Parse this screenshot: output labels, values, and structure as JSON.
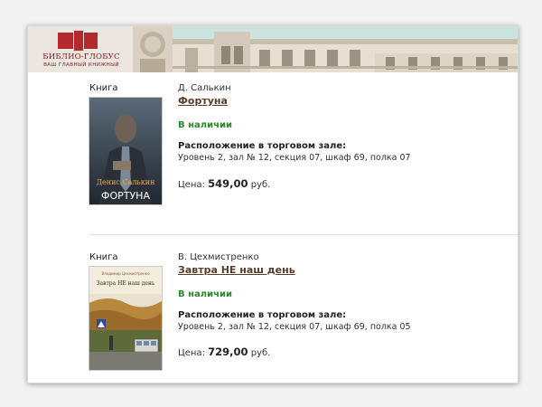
{
  "header": {
    "logo_title": "БИБЛИО-ГЛОБУС",
    "logo_subtitle": "ВАШ ГЛАВНЫЙ КНИЖНЫЙ"
  },
  "books": [
    {
      "type_label": "Книга",
      "author": "Д. Салькин",
      "title": "Фортуна",
      "availability": "В наличии",
      "location_heading": "Расположение в торговом зале:",
      "location": "Уровень 2, зал № 12, секция 07, шкаф 69, полка 07",
      "price_label": "Цена:",
      "price_value": "549,00",
      "price_currency": "руб.",
      "cover_author": "Денис Салькин",
      "cover_title": "ФОРТУНА"
    },
    {
      "type_label": "Книга",
      "author": "В. Цехмистренко",
      "title": "Завтра НЕ наш день",
      "availability": "В наличии",
      "location_heading": "Расположение в торговом зале:",
      "location": "Уровень 2, зал № 12, секция 07, шкаф 69, полка 05",
      "price_label": "Цена:",
      "price_value": "729,00",
      "price_currency": "руб.",
      "cover_title": "Завтра НЕ наш день"
    }
  ],
  "colors": {
    "title_link": "#5a3c2b",
    "availability": "#2a8a2a",
    "brand_red": "#b22a2e"
  }
}
